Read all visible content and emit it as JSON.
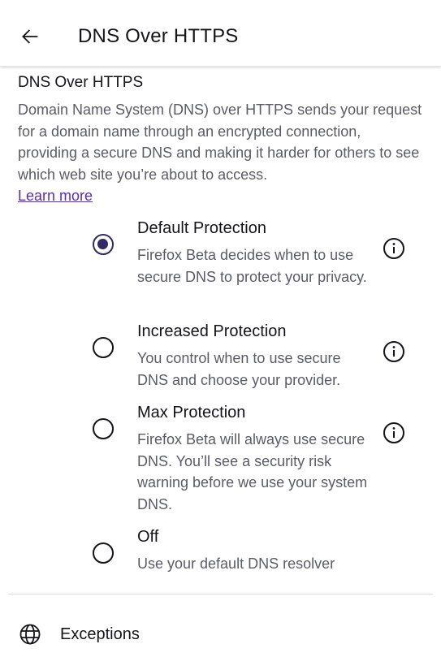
{
  "appbar": {
    "title": "DNS Over HTTPS",
    "back_icon": "arrow-back-icon"
  },
  "section": {
    "heading": "DNS Over HTTPS",
    "description": "Domain Name System (DNS) over HTTPS sends your request for a domain name through an encrypted connection, providing a secure DNS and making it harder for others to see which web site you’re about to access.",
    "learn_more": "Learn more"
  },
  "options": [
    {
      "title": "Default Protection",
      "description": "Firefox Beta decides when to use secure DNS to protect your privacy.",
      "checked": true,
      "has_info": true
    },
    {
      "title": "Increased Protection",
      "description": "You control when to use secure DNS and choose your provider.",
      "checked": false,
      "has_info": true
    },
    {
      "title": "Max Protection",
      "description": "Firefox Beta will always use secure DNS. You’ll see a security risk warning before we use your system DNS.",
      "checked": false,
      "has_info": true
    },
    {
      "title": "Off",
      "description": "Use your default DNS resolver",
      "checked": false,
      "has_info": false
    }
  ],
  "exceptions": {
    "label": "Exceptions",
    "icon": "globe-icon"
  },
  "colors": {
    "accent_radio": "#312a65",
    "link": "#592acb",
    "primary_text": "#15141a",
    "secondary_text": "#5b5b66"
  }
}
